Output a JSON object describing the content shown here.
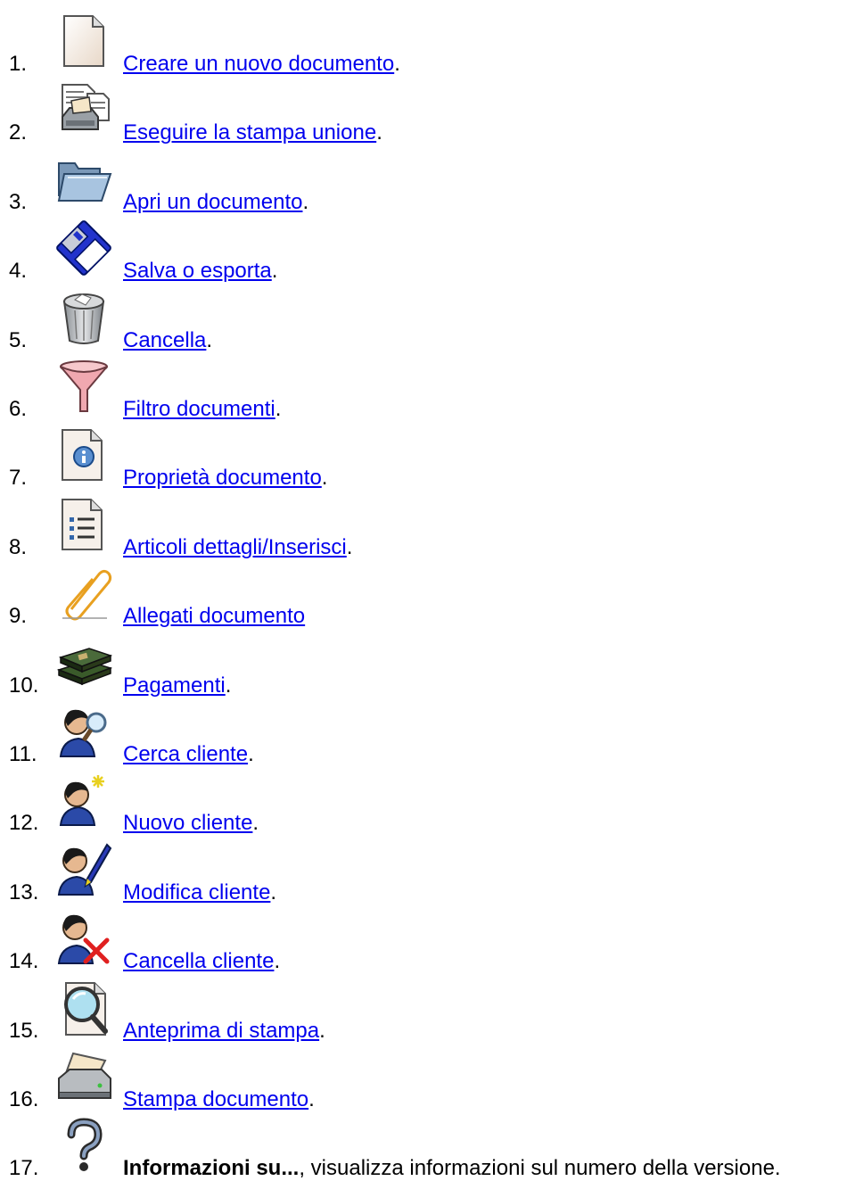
{
  "items": [
    {
      "n": "1.",
      "icon": "blank-document-icon",
      "link": "Creare un nuovo documento",
      "tail": "."
    },
    {
      "n": "2.",
      "icon": "mail-merge-icon",
      "link": "Eseguire la stampa unione",
      "tail": "."
    },
    {
      "n": "3.",
      "icon": "open-folder-icon",
      "link": "Apri un documento",
      "tail": "."
    },
    {
      "n": "4.",
      "icon": "floppy-disk-icon",
      "link": "Salva o esporta",
      "tail": "."
    },
    {
      "n": "5.",
      "icon": "trash-bin-icon",
      "link": "Cancella",
      "tail": "."
    },
    {
      "n": "6.",
      "icon": "funnel-filter-icon",
      "link": "Filtro documenti",
      "tail": "."
    },
    {
      "n": "7.",
      "icon": "document-info-icon",
      "link": "Proprietà documento",
      "tail": "."
    },
    {
      "n": "8.",
      "icon": "document-list-icon",
      "link": "Articoli dettagli/Inserisci",
      "tail": "."
    },
    {
      "n": "9.",
      "icon": "paperclip-icon",
      "link": "Allegati documento",
      "tail": ""
    },
    {
      "n": "10.",
      "icon": "money-stack-icon",
      "link": "Pagamenti",
      "tail": "."
    },
    {
      "n": "11.",
      "icon": "person-search-icon",
      "link": "Cerca cliente",
      "tail": "."
    },
    {
      "n": "12.",
      "icon": "person-new-icon",
      "link": "Nuovo cliente",
      "tail": "."
    },
    {
      "n": "13.",
      "icon": "person-edit-icon",
      "link": "Modifica cliente",
      "tail": "."
    },
    {
      "n": "14.",
      "icon": "person-delete-icon",
      "link": "Cancella cliente",
      "tail": "."
    },
    {
      "n": "15.",
      "icon": "print-preview-icon",
      "link": "Anteprima di stampa",
      "tail": "."
    },
    {
      "n": "16.",
      "icon": "printer-icon",
      "link": "Stampa documento",
      "tail": "."
    },
    {
      "n": "17.",
      "icon": "question-mark-icon",
      "bold": "Informazioni su...",
      "tail": ", visualizza informazioni sul numero della versione."
    }
  ]
}
